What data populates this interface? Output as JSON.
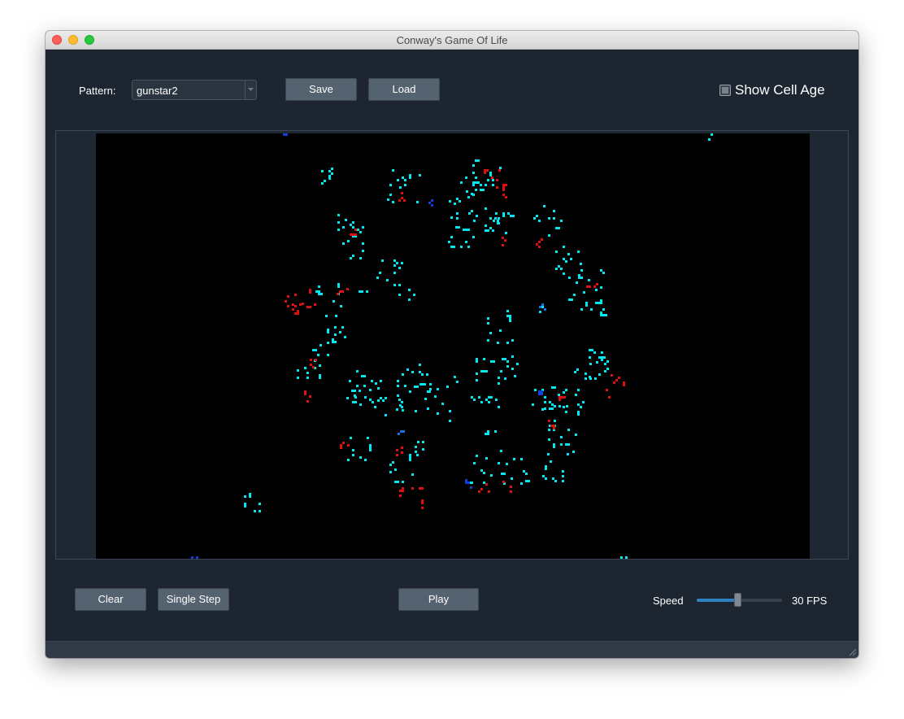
{
  "window": {
    "title": "Conway's Game Of Life"
  },
  "toolbar": {
    "pattern_label": "Pattern:",
    "pattern_value": "gunstar2",
    "save_label": "Save",
    "load_label": "Load",
    "show_cell_age_label": "Show Cell Age",
    "show_cell_age_checked": false
  },
  "controls": {
    "clear_label": "Clear",
    "single_step_label": "Single Step",
    "play_label": "Play",
    "speed_label": "Speed",
    "speed_value": 0.48,
    "fps_label": "30 FPS"
  },
  "board": {
    "background": "#000000",
    "cell_colors": {
      "young": "#00e8f0",
      "old": "#e01010",
      "ancient": "#1040d8",
      "mid": "#1670e0"
    }
  },
  "colors": {
    "window_bg": "#1c2530",
    "button_bg": "#556270",
    "accent": "#2f7fc1"
  },
  "icons": {
    "dropdown": "chevron-down-icon",
    "resize": "resize-grip-icon"
  }
}
